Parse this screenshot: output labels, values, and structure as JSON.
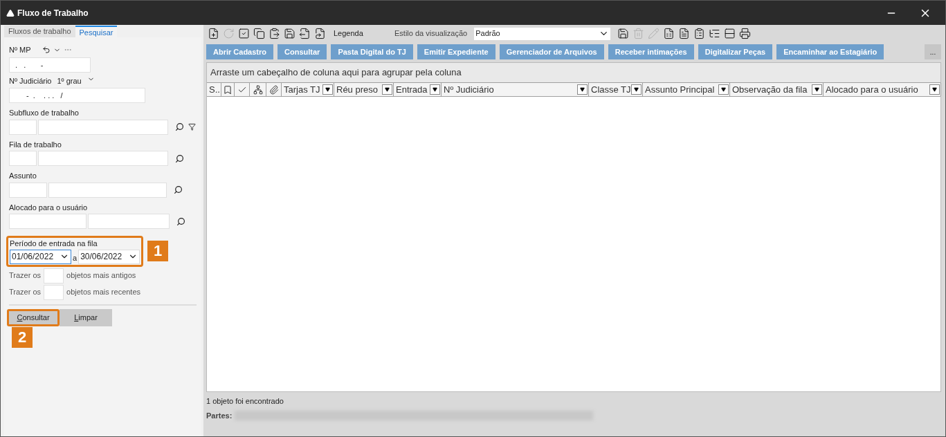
{
  "window": {
    "title": "Fluxo de Trabalho"
  },
  "left_panel": {
    "tabs": [
      {
        "label": "Fluxos de trabalho",
        "selected": false
      },
      {
        "label": "Pesquisar",
        "selected": true
      }
    ],
    "mp": {
      "label": "Nº MP",
      "value": ".   .       -"
    },
    "judicial": {
      "label": "Nº Judiciário",
      "instance": "1º grau",
      "value": "-  .    . . .   /"
    },
    "lookups": [
      {
        "label": "Subfluxo de trabalho",
        "kind": "filter"
      },
      {
        "label": "Fila de trabalho",
        "kind": "plain"
      },
      {
        "label": "Assunto",
        "kind": "plain"
      },
      {
        "label": "Alocado para o usuário",
        "kind": "plain"
      }
    ],
    "period": {
      "label": "Período de entrada na fila",
      "from": "01/06/2022",
      "separator": "a",
      "to": "30/06/2022",
      "callout": "1"
    },
    "limits": [
      {
        "prefix": "Trazer os",
        "suffix": "objetos mais antigos"
      },
      {
        "prefix": "Trazer os",
        "suffix": "objetos mais recentes"
      }
    ],
    "buttons": [
      {
        "label": "Consultar",
        "callout": "2"
      },
      {
        "label": "Limpar"
      }
    ]
  },
  "toolbar": {
    "icons": [
      {
        "kind": "new",
        "disabled": false
      },
      {
        "kind": "refresh",
        "disabled": true
      },
      {
        "kind": "check-copy",
        "disabled": false
      },
      {
        "kind": "copy",
        "disabled": false
      },
      {
        "kind": "paste",
        "disabled": false
      },
      {
        "kind": "save-copy",
        "disabled": false
      },
      {
        "kind": "export",
        "disabled": false
      },
      {
        "kind": "legend",
        "disabled": false
      }
    ],
    "legend": "Legenda",
    "style_label": "Estilo da visualização",
    "style_value": "Padrão",
    "icons_right": [
      {
        "kind": "save",
        "disabled": false
      },
      {
        "kind": "trash",
        "disabled": true
      },
      {
        "kind": "edit",
        "disabled": true
      },
      {
        "kind": "excel",
        "disabled": false
      },
      {
        "kind": "doc",
        "disabled": false
      },
      {
        "kind": "form",
        "disabled": false
      },
      {
        "kind": "tree",
        "disabled": false
      },
      {
        "kind": "collapse",
        "disabled": false
      },
      {
        "kind": "print",
        "disabled": false
      }
    ]
  },
  "actions": [
    "Abrir Cadastro",
    "Consultar",
    "Pasta Digital do TJ",
    "Emitir Expediente",
    "Gerenciador de Arquivos",
    "Receber intimações",
    "Digitalizar Peças",
    "Encaminhar ao Estagiário"
  ],
  "more": "...",
  "grid": {
    "group_hint": "Arraste um cabeçalho de coluna aqui para agrupar pela coluna",
    "columns": [
      {
        "kind": "text",
        "label": "S.."
      },
      {
        "kind": "bookmark"
      },
      {
        "kind": "check"
      },
      {
        "kind": "tree"
      },
      {
        "kind": "clip"
      },
      {
        "kind": "filter",
        "label": "Tarjas TJ"
      },
      {
        "kind": "filter",
        "label": "Réu preso"
      },
      {
        "kind": "filter",
        "label": "Entrada"
      },
      {
        "kind": "filter",
        "label": "Nº Judiciário"
      },
      {
        "kind": "filter",
        "label": "Classe TJ"
      },
      {
        "kind": "filter",
        "label": "Assunto Principal"
      },
      {
        "kind": "filter",
        "label": "Observação da fila"
      },
      {
        "kind": "filter",
        "label": "Alocado para o usuário"
      }
    ]
  },
  "status": {
    "count": "1 objeto foi encontrado",
    "parties_label": "Partes:"
  }
}
